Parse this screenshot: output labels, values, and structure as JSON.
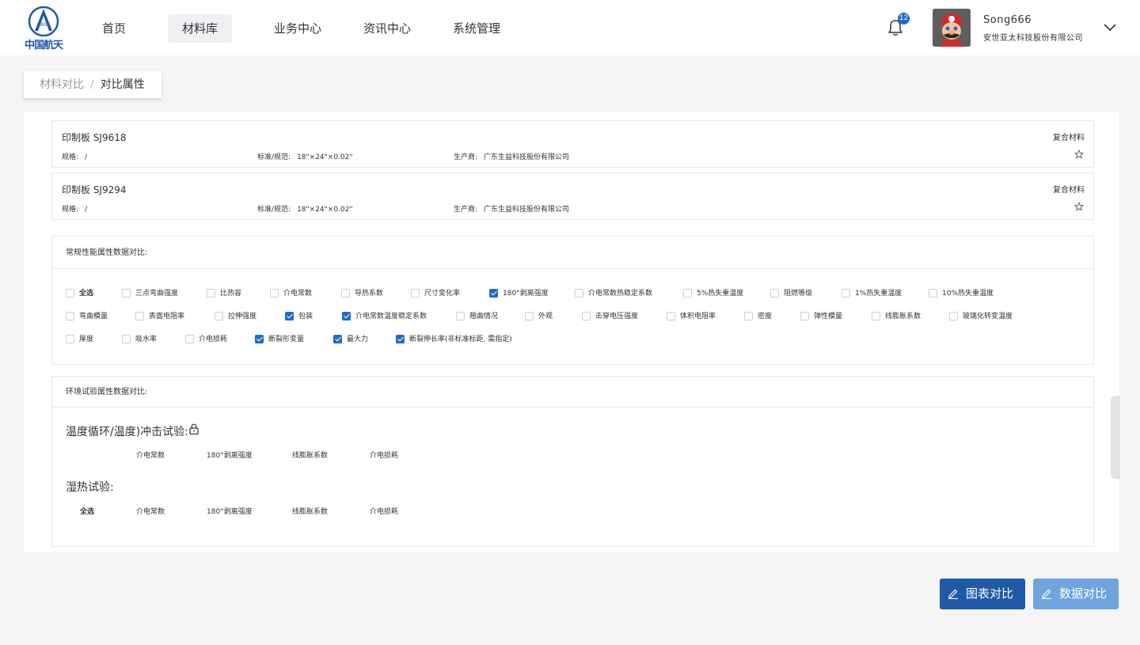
{
  "header": {
    "logo_badge": "CASC",
    "logo_text": "中国航天",
    "nav": [
      "首页",
      "材料库",
      "业务中心",
      "资讯中心",
      "系统管理"
    ],
    "active_nav": "材料库",
    "notification_count": "12",
    "user": {
      "name": "Song666",
      "company": "安世亚太科技股份有限公司"
    }
  },
  "breadcrumb": {
    "parent": "材料对比",
    "separator": "/",
    "current": "对比属性"
  },
  "materials": [
    {
      "title": "印制板 SJ9618",
      "type": "复合材料",
      "spec_label": "规格:",
      "spec_value": "/",
      "standard_label": "标准/规范:",
      "standard_value": "18\"×24\"×0.02\"",
      "maker_label": "生产商:",
      "maker_value": "广东生益科技股份有限公司"
    },
    {
      "title": "印制板 SJ9294",
      "type": "复合材料",
      "spec_label": "规格:",
      "spec_value": "/",
      "standard_label": "标准/规范:",
      "standard_value": "18\"×24\"×0.02\"",
      "maker_label": "生产商:",
      "maker_value": "广东生益科技股份有限公司"
    }
  ],
  "regular_section": {
    "title": "常规性能属性数据对比:",
    "rows": [
      [
        {
          "label": "全选",
          "checked": false,
          "bold": true
        },
        {
          "label": "三点弯曲强度",
          "checked": false
        },
        {
          "label": "比热容",
          "checked": false
        },
        {
          "label": "介电常数",
          "checked": false
        },
        {
          "label": "导热系数",
          "checked": false
        },
        {
          "label": "尺寸变化率",
          "checked": false
        },
        {
          "label": "180°剥离强度",
          "checked": true
        },
        {
          "label": "介电常数热稳定系数",
          "checked": false
        },
        {
          "label": "5%热失重温度",
          "checked": false
        },
        {
          "label": "阻燃等级",
          "checked": false
        },
        {
          "label": "1%热失重温度",
          "checked": false
        },
        {
          "label": "10%热失重温度",
          "checked": false
        }
      ],
      [
        {
          "label": "弯曲模量",
          "checked": false
        },
        {
          "label": "表面电阻率",
          "checked": false
        },
        {
          "label": "拉伸强度",
          "checked": false
        },
        {
          "label": "包装",
          "checked": true
        },
        {
          "label": "介电常数温度稳定系数",
          "checked": true
        },
        {
          "label": "翘曲情况",
          "checked": false
        },
        {
          "label": "外观",
          "checked": false
        },
        {
          "label": "击穿电压强度",
          "checked": false
        },
        {
          "label": "体积电阻率",
          "checked": false
        },
        {
          "label": "密度",
          "checked": false
        },
        {
          "label": "弹性模量",
          "checked": false
        },
        {
          "label": "线膨胀系数",
          "checked": false
        },
        {
          "label": "玻璃化转变温度",
          "checked": false
        }
      ],
      [
        {
          "label": "厚度",
          "checked": false
        },
        {
          "label": "吸水率",
          "checked": false
        },
        {
          "label": "介电损耗",
          "checked": false
        },
        {
          "label": "断裂形变量",
          "checked": true
        },
        {
          "label": "最大力",
          "checked": true
        },
        {
          "label": "断裂伸长率(非标准标距, 需指定)",
          "checked": true
        }
      ]
    ]
  },
  "env_section": {
    "title": "环境试验属性数据对比:",
    "tests": [
      {
        "title": "温度循环/温度)冲击试验:",
        "locked": true,
        "select_all": "",
        "props": [
          "介电常数",
          "180°剥离强度",
          "线膨胀系数",
          "介电损耗"
        ]
      },
      {
        "title": "湿热试验:",
        "locked": false,
        "select_all": "全选",
        "props": [
          "介电常数",
          "180°剥离强度",
          "线膨胀系数",
          "介电损耗"
        ]
      }
    ]
  },
  "buttons": {
    "chart_compare": "图表对比",
    "data_compare": "数据对比"
  },
  "colors": {
    "primary": "#1e5aa8",
    "primary_light": "#6fa5df",
    "check": "#1e6cc8"
  }
}
